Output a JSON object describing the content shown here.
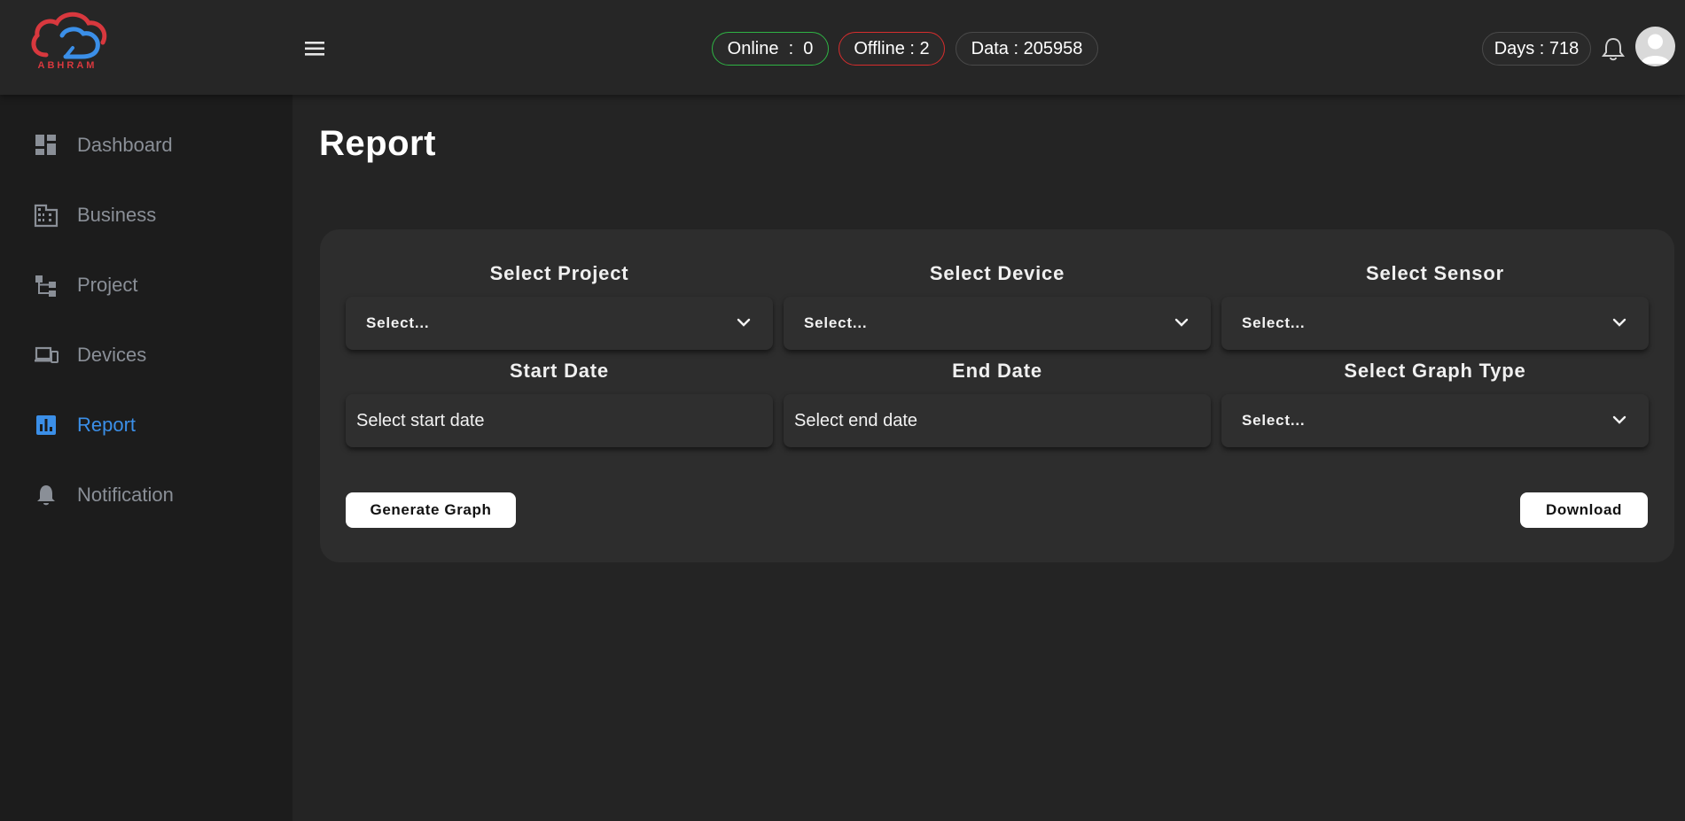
{
  "brand": {
    "logo_text": "ABHRAM",
    "colors": {
      "red": "#d8383e",
      "blue": "#3b8fe8"
    }
  },
  "header": {
    "online_label": "Online  :  0",
    "offline_label": "Offline : 2",
    "data_label": "Data : 205958",
    "days_label": "Days : 718",
    "icons": [
      "menu-icon",
      "bell-icon",
      "avatar-icon"
    ]
  },
  "sidebar": {
    "items": [
      {
        "label": "Dashboard",
        "icon": "dashboard-icon"
      },
      {
        "label": "Business",
        "icon": "building-icon"
      },
      {
        "label": "Project",
        "icon": "hierarchy-icon"
      },
      {
        "label": "Devices",
        "icon": "devices-icon"
      },
      {
        "label": "Report",
        "icon": "bar-chart-icon",
        "active": true
      },
      {
        "label": "Notification",
        "icon": "bell-icon"
      }
    ],
    "active_color": "#3b8fe8"
  },
  "main": {
    "title": "Report",
    "form": {
      "project_label": "Select Project",
      "device_label": "Select Device",
      "sensor_label": "Select Sensor",
      "start_label": "Start Date",
      "end_label": "End Date",
      "graph_type_label": "Select Graph Type",
      "project_value": "Select...",
      "device_value": "Select...",
      "sensor_value": "Select...",
      "graph_type_value": "Select...",
      "start_placeholder": "Select start date",
      "end_placeholder": "Select end date"
    },
    "buttons": {
      "generate": "Generate Graph",
      "download": "Download"
    }
  }
}
